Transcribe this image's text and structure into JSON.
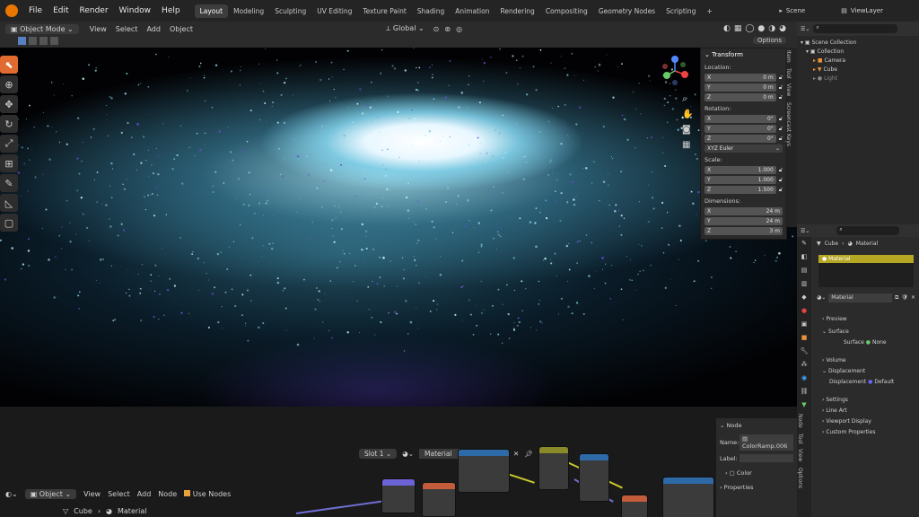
{
  "menu": [
    "File",
    "Edit",
    "Render",
    "Window",
    "Help"
  ],
  "workspace_tabs": [
    "Layout",
    "Modeling",
    "Sculpting",
    "UV Editing",
    "Texture Paint",
    "Shading",
    "Animation",
    "Rendering",
    "Compositing",
    "Geometry Nodes",
    "Scripting"
  ],
  "active_tab": "Layout",
  "scene": "Scene",
  "view_layer": "ViewLayer",
  "header": {
    "mode": "Object Mode",
    "view": "View",
    "select": "Select",
    "add": "Add",
    "object": "Object",
    "orientation": "Global",
    "options": "Options"
  },
  "npanel": {
    "title": "Transform",
    "location_label": "Location:",
    "location": [
      {
        "axis": "X",
        "value": "0 m"
      },
      {
        "axis": "Y",
        "value": "0 m"
      },
      {
        "axis": "Z",
        "value": "0 m"
      }
    ],
    "rotation_label": "Rotation:",
    "rotation": [
      {
        "axis": "X",
        "value": "0°"
      },
      {
        "axis": "Y",
        "value": "0°"
      },
      {
        "axis": "Z",
        "value": "0°"
      }
    ],
    "rotation_mode": "XYZ Euler",
    "scale_label": "Scale:",
    "scale": [
      {
        "axis": "X",
        "value": "1.000"
      },
      {
        "axis": "Y",
        "value": "1.000"
      },
      {
        "axis": "Z",
        "value": "1.500"
      }
    ],
    "dimensions_label": "Dimensions:",
    "dimensions": [
      {
        "axis": "X",
        "value": "24 m"
      },
      {
        "axis": "Y",
        "value": "24 m"
      },
      {
        "axis": "Z",
        "value": "3 m"
      }
    ]
  },
  "vtabs": [
    "Item",
    "Tool",
    "View",
    "Screencast Keys"
  ],
  "outliner": {
    "root": "Scene Collection",
    "collection": "Collection",
    "items": [
      "Camera",
      "Cube",
      "Light"
    ]
  },
  "properties": {
    "object": "Cube",
    "material": "Material",
    "slot_material": "Material",
    "material_name": "Material",
    "sections": [
      "Preview",
      "Surface",
      "Volume",
      "Displacement",
      "Settings",
      "Line Art",
      "Viewport Display",
      "Custom Properties"
    ],
    "surface_label": "Surface",
    "surface_value": "None",
    "displacement_label": "Displacement",
    "displacement_value": "Default"
  },
  "node_editor": {
    "mode": "Object",
    "view": "View",
    "select": "Select",
    "add": "Add",
    "node": "Node",
    "use_nodes": "Use Nodes",
    "slot": "Slot 1",
    "material": "Material",
    "object": "Cube",
    "breadcrumb_material": "Material"
  },
  "node_side": {
    "section": "Node",
    "name_label": "Name:",
    "name_value": "ColorRamp.006",
    "label_label": "Label:",
    "color_label": "Color",
    "properties_label": "Properties"
  },
  "node_side_tabs": [
    "Node",
    "Tool",
    "View",
    "Options"
  ]
}
